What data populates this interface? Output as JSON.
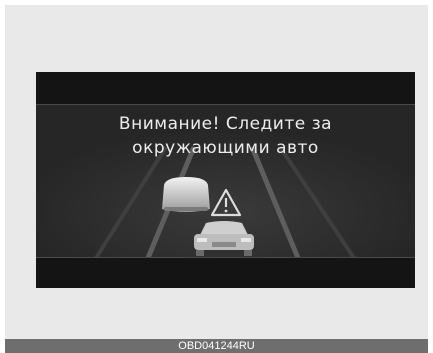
{
  "display": {
    "warning_line_1": "Внимание! Следите за",
    "warning_line_2": "окружающими авто",
    "background_color": "#1d1d1d",
    "text_color": "#ededed"
  },
  "icons": {
    "warning": "warning-triangle-icon",
    "adjacent_car": "adjacent-vehicle-icon",
    "own_car": "own-vehicle-icon"
  },
  "caption": {
    "code": "OBD041244RU"
  }
}
